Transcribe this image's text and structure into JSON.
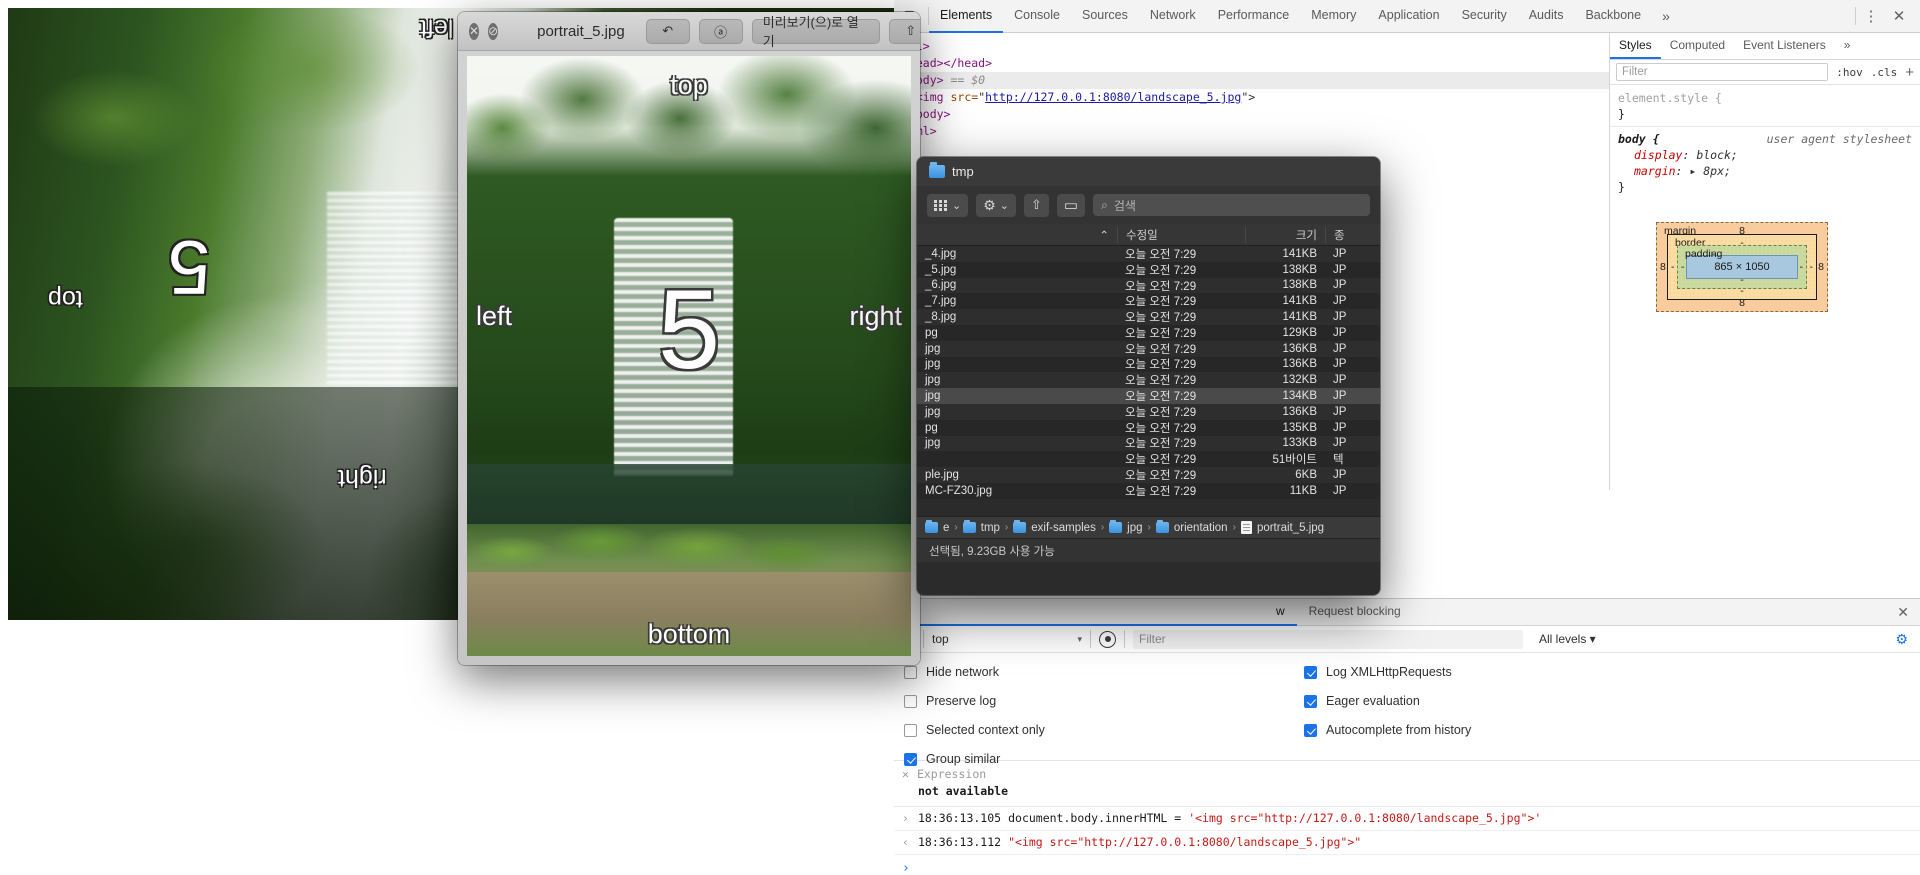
{
  "background_page": {
    "image_labels": {
      "top": "top",
      "left": "left",
      "right": "right",
      "bottom": "bottom",
      "number": "5"
    }
  },
  "quicklook": {
    "title": "portrait_5.jpg",
    "close_label": "✕",
    "block_label": "⊘",
    "rotate_label": "↶",
    "markup_label": "ⓐ",
    "open_with_label": "미리보기(으)로 열기",
    "share_label": "⇧",
    "image_labels": {
      "top": "top",
      "left": "left",
      "right": "right",
      "bottom": "bottom",
      "number": "5"
    }
  },
  "devtools": {
    "tabs": [
      {
        "label": "Elements",
        "active": true
      },
      {
        "label": "Console",
        "active": false
      },
      {
        "label": "Sources",
        "active": false
      },
      {
        "label": "Network",
        "active": false
      },
      {
        "label": "Performance",
        "active": false
      },
      {
        "label": "Memory",
        "active": false
      },
      {
        "label": "Application",
        "active": false
      },
      {
        "label": "Security",
        "active": false
      },
      {
        "label": "Audits",
        "active": false
      },
      {
        "label": "Backbone",
        "active": false
      }
    ],
    "more_label": "»",
    "menu_label": "⋮",
    "close_label": "✕",
    "inspect_icon_label": "device-toolbar",
    "dom": {
      "line1": "tml>",
      "line2": "<head></head>",
      "line3_tag": "<body>",
      "line3_sel": "== $0",
      "line4_pre": "<img ",
      "line4_attr": "src=",
      "line4_q1": "\"",
      "line4_url": "http://127.0.0.1:8080/landscape_5.jpg",
      "line4_q2": "\">",
      "line5": "</body>",
      "line6": "html>"
    },
    "styles": {
      "tabs": [
        {
          "label": "Styles",
          "active": true
        },
        {
          "label": "Computed",
          "active": false
        },
        {
          "label": "Event Listeners",
          "active": false
        }
      ],
      "more_label": "»",
      "filter_placeholder": "Filter",
      "hov_label": ":hov",
      "cls_label": ".cls",
      "plus_label": "+",
      "rule_element_style": "element.style {",
      "rule_close": "}",
      "rule_body_selector": "body {",
      "rule_body_source": "user agent stylesheet",
      "prop1_name": "display",
      "prop1_value": ": block;",
      "prop2_name": "margin",
      "prop2_value": ": ▸ 8px;"
    },
    "box_model": {
      "margin_label": "margin",
      "margin_top": "8",
      "margin_right": "8",
      "margin_bottom": "8",
      "margin_left": "8",
      "border_label": "border",
      "border_top": "-",
      "border_right": "-",
      "border_bottom": "-",
      "border_left": "-",
      "padding_label": "padding",
      "padding_top": "-",
      "padding_right": "-",
      "padding_bottom": "-",
      "padding_left": "-",
      "content_size": "865 × 1050"
    },
    "drawer": {
      "tabs": [
        {
          "label": "w",
          "active": true
        },
        {
          "label": "Request blocking",
          "active": false
        }
      ],
      "close_label": "✕",
      "console_toolbar": {
        "clear_label": "clear-console",
        "context": "top",
        "context_caret": "▾",
        "eye_label": "live-expression",
        "filter_placeholder": "Filter",
        "levels": "All levels ▾",
        "settings_label": "⚙"
      },
      "settings": {
        "left": [
          {
            "label": "Hide network",
            "checked": false
          },
          {
            "label": "Preserve log",
            "checked": false
          },
          {
            "label": "Selected context only",
            "checked": false
          },
          {
            "label": "Group similar",
            "checked": true
          }
        ],
        "right": [
          {
            "label": "Log XMLHttpRequests",
            "checked": true
          },
          {
            "label": "Eager evaluation",
            "checked": true
          },
          {
            "label": "Autocomplete from history",
            "checked": true
          }
        ]
      },
      "live_expression": {
        "remove_label": "✕",
        "name": "Expression",
        "value": "not available"
      },
      "console_lines": [
        {
          "marker": "›",
          "time": "18:36:13.105",
          "code_pre": "document.body.innerHTML = ",
          "code_str": "'<img src=\"http://127.0.0.1:8080/landscape_5.jpg\">'"
        },
        {
          "marker": "‹",
          "time": "18:36:13.112",
          "code_pre": "",
          "code_str": "\"<img src=\"http://127.0.0.1:8080/landscape_5.jpg\">\""
        }
      ],
      "prompt": "›"
    }
  },
  "finder": {
    "title": "tmp",
    "toolbar": {
      "view_label": "░░",
      "view_caret": "⌄",
      "action_label": "⚙",
      "action_caret": "⌄",
      "share_label": "⇧",
      "tag_label": "▭",
      "search_icon": "⌕",
      "search_placeholder": "검색"
    },
    "columns": {
      "name": "⌃",
      "date": "수정일",
      "size": "크기",
      "kind": "종"
    },
    "rows": [
      {
        "name": "_4.jpg",
        "date": "오늘 오전 7:29",
        "size": "141KB",
        "kind": "JP",
        "highlight": false
      },
      {
        "name": "_5.jpg",
        "date": "오늘 오전 7:29",
        "size": "138KB",
        "kind": "JP",
        "highlight": false
      },
      {
        "name": "_6.jpg",
        "date": "오늘 오전 7:29",
        "size": "138KB",
        "kind": "JP",
        "highlight": false
      },
      {
        "name": "_7.jpg",
        "date": "오늘 오전 7:29",
        "size": "141KB",
        "kind": "JP",
        "highlight": false
      },
      {
        "name": "_8.jpg",
        "date": "오늘 오전 7:29",
        "size": "141KB",
        "kind": "JP",
        "highlight": false
      },
      {
        "name": "pg",
        "date": "오늘 오전 7:29",
        "size": "129KB",
        "kind": "JP",
        "highlight": false
      },
      {
        "name": "jpg",
        "date": "오늘 오전 7:29",
        "size": "136KB",
        "kind": "JP",
        "highlight": false
      },
      {
        "name": "jpg",
        "date": "오늘 오전 7:29",
        "size": "136KB",
        "kind": "JP",
        "highlight": false
      },
      {
        "name": "jpg",
        "date": "오늘 오전 7:29",
        "size": "132KB",
        "kind": "JP",
        "highlight": false
      },
      {
        "name": "jpg",
        "date": "오늘 오전 7:29",
        "size": "134KB",
        "kind": "JP",
        "highlight": true
      },
      {
        "name": "jpg",
        "date": "오늘 오전 7:29",
        "size": "136KB",
        "kind": "JP",
        "highlight": false
      },
      {
        "name": "pg",
        "date": "오늘 오전 7:29",
        "size": "135KB",
        "kind": "JP",
        "highlight": false
      },
      {
        "name": "jpg",
        "date": "오늘 오전 7:29",
        "size": "133KB",
        "kind": "JP",
        "highlight": false
      },
      {
        "name": "",
        "date": "오늘 오전 7:29",
        "size": "51바이트",
        "kind": "텍",
        "highlight": false
      },
      {
        "name": "ple.jpg",
        "date": "오늘 오전 7:29",
        "size": "6KB",
        "kind": "JP",
        "highlight": false
      },
      {
        "name": "MC-FZ30.jpg",
        "date": "오늘 오전 7:29",
        "size": "11KB",
        "kind": "JP",
        "highlight": false
      }
    ],
    "path_bar": [
      {
        "label": "e",
        "type": "folder"
      },
      {
        "label": "tmp",
        "type": "folder"
      },
      {
        "label": "exif-samples",
        "type": "folder"
      },
      {
        "label": "jpg",
        "type": "folder"
      },
      {
        "label": "orientation",
        "type": "folder"
      },
      {
        "label": "portrait_5.jpg",
        "type": "document"
      }
    ],
    "path_separator": "›",
    "status": "선택됨, 9.23GB 사용 가능"
  }
}
